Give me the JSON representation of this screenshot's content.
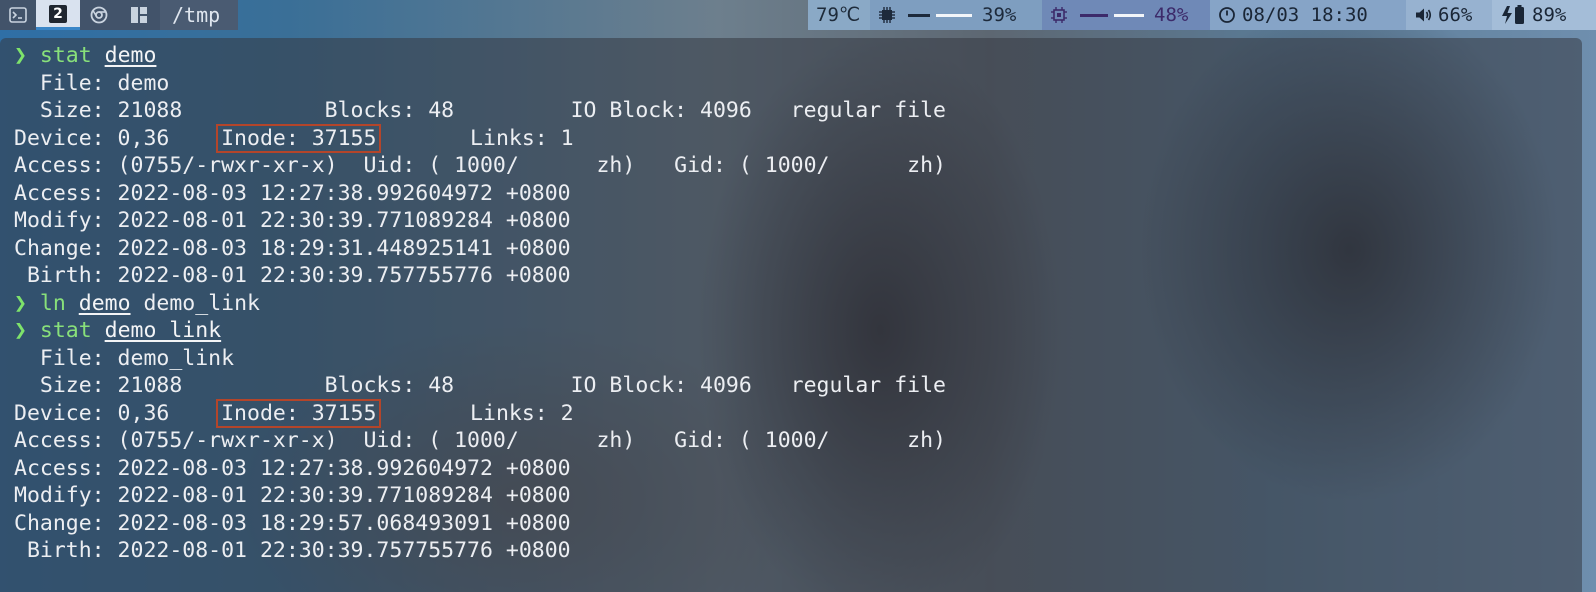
{
  "topbar": {
    "workspaces": [
      {
        "id": "1",
        "icon": "terminal-icon"
      },
      {
        "id": "2",
        "label": "2",
        "active": true
      },
      {
        "id": "3",
        "icon": "browser-icon"
      },
      {
        "id": "4",
        "icon": "grid-icon"
      }
    ],
    "cwd": "/tmp",
    "temperature": "79℃",
    "cpu": {
      "icon": "cpu-icon",
      "percent": "39%",
      "level": 0.39
    },
    "memory": {
      "icon": "memory-icon",
      "percent": "48%",
      "level": 0.48
    },
    "clock": {
      "icon": "clock-icon",
      "text": "08/03 18:30"
    },
    "volume": {
      "icon": "speaker-icon",
      "percent": "66%"
    },
    "battery": {
      "icon": "battery-charging-icon",
      "percent": "89%"
    },
    "colors": {
      "active_workspace": "#d9e2ef",
      "underline": "#3a86c8"
    }
  },
  "terminal": {
    "prompt_symbol": "❯",
    "colors": {
      "prompt": "#7ee36b",
      "text": "#eef0f3",
      "highlight_box": "#b4452a"
    },
    "block1": {
      "cmd": "stat",
      "arg": "demo",
      "file": "  File: demo",
      "size_line": "  Size: 21088           Blocks: 48         IO Block: 4096   regular file",
      "device_pre": "Device: 0,36    ",
      "inode": "Inode: 37155",
      "device_post": "       Links: 1",
      "access_perm": "Access: (0755/-rwxr-xr-x)  Uid: ( 1000/      zh)   Gid: ( 1000/      zh)",
      "access_time": "Access: 2022-08-03 12:27:38.992604972 +0800",
      "modify_time": "Modify: 2022-08-01 22:30:39.771089284 +0800",
      "change_time": "Change: 2022-08-03 18:29:31.448925141 +0800",
      "birth_time": " Birth: 2022-08-01 22:30:39.757755776 +0800"
    },
    "ln_cmd": {
      "cmd": "ln",
      "arg1": "demo",
      "arg2": " demo_link"
    },
    "block2": {
      "cmd": "stat",
      "arg": "demo_link",
      "file": "  File: demo_link",
      "size_line": "  Size: 21088           Blocks: 48         IO Block: 4096   regular file",
      "device_pre": "Device: 0,36    ",
      "inode": "Inode: 37155",
      "device_post": "       Links: 2",
      "access_perm": "Access: (0755/-rwxr-xr-x)  Uid: ( 1000/      zh)   Gid: ( 1000/      zh)",
      "access_time": "Access: 2022-08-03 12:27:38.992604972 +0800",
      "modify_time": "Modify: 2022-08-01 22:30:39.771089284 +0800",
      "change_time": "Change: 2022-08-03 18:29:57.068493091 +0800",
      "birth_time": " Birth: 2022-08-01 22:30:39.757755776 +0800"
    }
  }
}
